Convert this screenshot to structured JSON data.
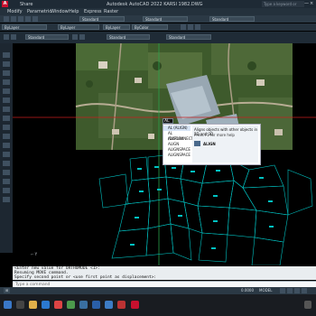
{
  "title_bar": {
    "share_label": "Share",
    "title": "Autodesk AutoCAD 2022   KARSI 1982.DWG",
    "search_placeholder": "Type a keyword or phrase"
  },
  "menu": {
    "items": [
      "Modify",
      "Parametric",
      "Window",
      "Help",
      "Express",
      "Raster"
    ]
  },
  "toolbar": {
    "style_1": "Standard",
    "style_2": "Standard",
    "style_3": "Standard",
    "layer_1": "ByLayer",
    "layer_2": "ByLayer",
    "layer_3": "ByLayer",
    "color": "ByColor",
    "row3_standard_1": "Standard",
    "row3_standard_2": "Standard",
    "row3_standard_3": "Standard"
  },
  "autocomplete": {
    "typed": "AL",
    "items": [
      "AL (ALIGN)",
      "AL (DISCONNECT)",
      "ALLPLAY",
      "ALIGN",
      "ALIGNSPACE",
      "ALIGNSPACE"
    ],
    "selected_index": 0,
    "tooltip": "Aligns objects with other objects in 2D and 3D",
    "help": "Press F1 for more help",
    "subtitle": "ALIGN"
  },
  "command_history": [
    "<Enter new value for ORTHOMODE <1>:",
    "Resuming MOVE command.",
    "Specify second point or <use first point as displacement>:"
  ],
  "command_prompt": "Type a command",
  "status": {
    "coords": "0.0000",
    "model": "MODEL"
  },
  "colors": {
    "accent": "#00c2c2",
    "red_axis": "#c81e1e",
    "green_axis": "#2aa24a",
    "canvas": "#000000"
  }
}
